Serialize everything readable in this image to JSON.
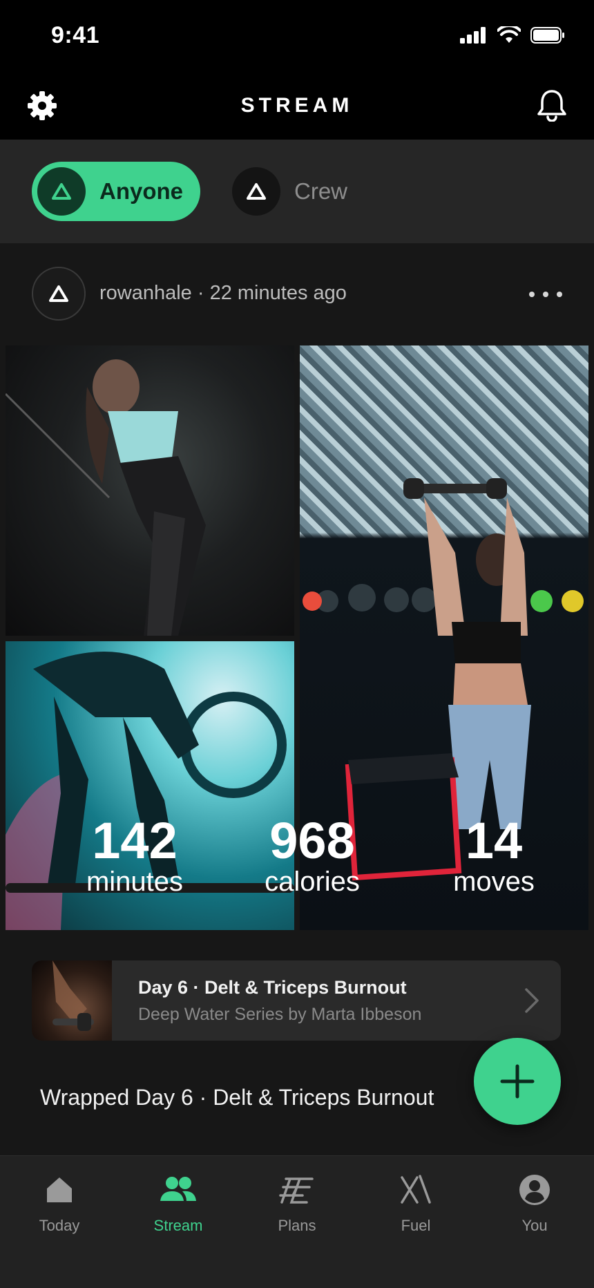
{
  "status_bar": {
    "time": "9:41"
  },
  "header": {
    "title": "STREAM"
  },
  "filters": [
    {
      "label": "Anyone",
      "active": true
    },
    {
      "label": "Crew",
      "active": false
    }
  ],
  "post": {
    "author": "rowanhale",
    "time_ago": "22 minutes ago",
    "meta": "rowanhale · 22 minutes ago",
    "stats": [
      {
        "value": "142",
        "unit": "minutes"
      },
      {
        "value": "968",
        "unit": "calories"
      },
      {
        "value": "14",
        "unit": "moves"
      }
    ],
    "workout": {
      "title": "Day 6 · Delt & Triceps Burnout",
      "subtitle": "Deep Water Series by Marta Ibbeson"
    },
    "caption": "Wrapped Day 6 · Delt & Triceps Burnout"
  },
  "tabs": [
    {
      "label": "Today",
      "icon": "home-icon",
      "active": false
    },
    {
      "label": "Stream",
      "icon": "people-icon",
      "active": true
    },
    {
      "label": "Plans",
      "icon": "plans-icon",
      "active": false
    },
    {
      "label": "Fuel",
      "icon": "fuel-icon",
      "active": false
    },
    {
      "label": "You",
      "icon": "profile-icon",
      "active": false
    }
  ],
  "colors": {
    "accent": "#3fd28e",
    "background": "#171717",
    "surface": "#262626",
    "tab_bar": "#222222"
  }
}
